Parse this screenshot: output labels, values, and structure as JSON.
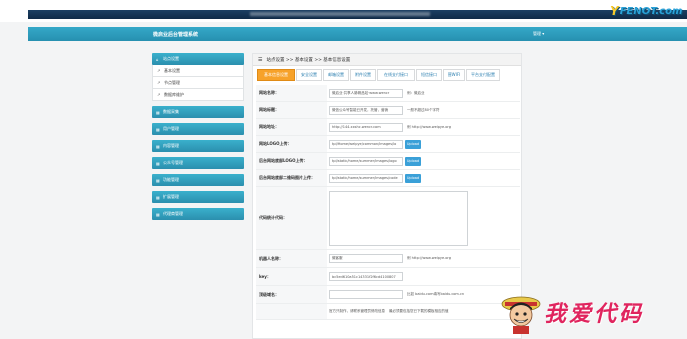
{
  "site_logo": {
    "text": "FENOT.com",
    "mark": "Y"
  },
  "header": {
    "title": "微启业后台管理系统",
    "user": "管理 ▾"
  },
  "sidebar": [
    {
      "label": "站点设置",
      "icon": "home-icon",
      "glyph": "⌂",
      "type": "main"
    },
    {
      "label": "基本设置",
      "icon": "arrow-icon",
      "glyph": "↗",
      "type": "sub"
    },
    {
      "label": "节点管理",
      "icon": "arrow-icon",
      "glyph": "↗",
      "type": "sub"
    },
    {
      "label": "数据库维护",
      "icon": "arrow-icon",
      "glyph": "↗",
      "type": "sub"
    },
    {
      "label": "数据采集",
      "icon": "grid-icon",
      "glyph": "▦",
      "type": "main"
    },
    {
      "label": "用户管理",
      "icon": "grid-icon",
      "glyph": "▦",
      "type": "main"
    },
    {
      "label": "内容管理",
      "icon": "grid-icon",
      "glyph": "▦",
      "type": "main"
    },
    {
      "label": "公众号管理",
      "icon": "grid-icon",
      "glyph": "▦",
      "type": "main"
    },
    {
      "label": "功能管理",
      "icon": "grid-icon",
      "glyph": "▦",
      "type": "main"
    },
    {
      "label": "扩展管理",
      "icon": "grid-icon",
      "glyph": "▦",
      "type": "main"
    },
    {
      "label": "代理商管理",
      "icon": "grid-icon",
      "glyph": "▦",
      "type": "main"
    }
  ],
  "breadcrumb": "站点设置 >> 基本设置 >> 基本信息设置",
  "tabs": [
    {
      "label": "基本信息设置",
      "active": true
    },
    {
      "label": "安全设置",
      "active": false
    },
    {
      "label": "邮箱设置",
      "active": false
    },
    {
      "label": "附件设置",
      "active": false
    },
    {
      "label": "在线支付接口",
      "active": false
    },
    {
      "label": "短信接口",
      "active": false
    },
    {
      "label": "营WIFI",
      "active": false
    },
    {
      "label": "平台支付配置",
      "active": false
    }
  ],
  "form": {
    "site_name": {
      "label": "网站名称：",
      "value": "微启业·共享人脉精品站·www.wencr",
      "hint": "例：微启业"
    },
    "site_title": {
      "label": "网站标题：",
      "value": "微信公众号智能已开发，托管，营销",
      "hint": "一般不超过80个字符"
    },
    "site_url": {
      "label": "网站地址：",
      "value": "http://144.xxshc.wencr.com",
      "hint": "例 http://www.weipye.org"
    },
    "site_logo": {
      "label": "网站LOGO上传：",
      "value": "tpl/Home/weipye/common/images/lo",
      "button": "Upload"
    },
    "backend_logo": {
      "label": "后台网站底部LOGO上传：",
      "value": "tpl/static/home/summer/images/logo",
      "button": "Upload"
    },
    "qrcode": {
      "label": "后台网站底部二维码图片上传：",
      "value": "tpl/static/home/summer/images/code",
      "button": "Upload"
    },
    "stats_code": {
      "label": "代码统计代码："
    },
    "robot_name": {
      "label": "机器人名称：",
      "value": "微客服",
      "hint": "例 http://www.weipye.org"
    },
    "key": {
      "label": "key：",
      "value": "bc5ed610a51c14331f2f6cd4100807"
    },
    "top_domain": {
      "label": "顶级域名：",
      "value": "",
      "hint": "比如 baidu.com填写baidu.com.cn"
    },
    "footer_note": {
      "label": "",
      "value": "官方只制作，请联系管理员修改信息",
      "note": "最必须要包括您已下载的模板相应的值"
    }
  },
  "watermark": {
    "text": "我爱代码"
  }
}
